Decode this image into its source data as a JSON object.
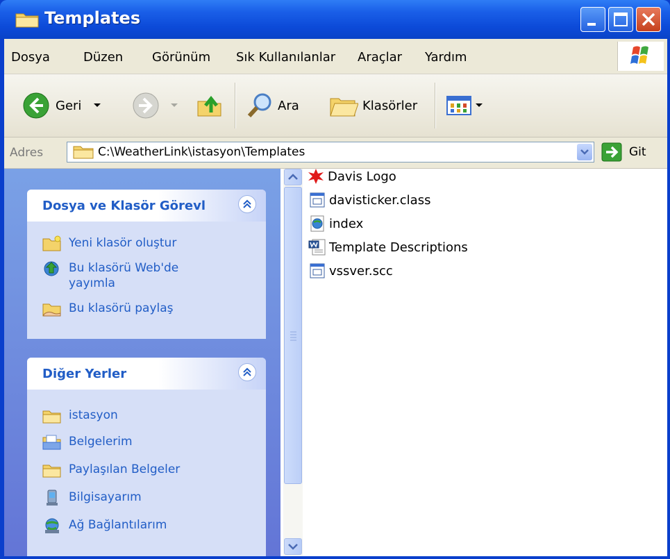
{
  "window": {
    "title": "Templates"
  },
  "menu": [
    "Dosya",
    "Düzen",
    "Görünüm",
    "Sık Kullanılanlar",
    "Araçlar",
    "Yardım"
  ],
  "toolbar": {
    "back_label": "Geri",
    "search_label": "Ara",
    "folders_label": "Klasörler"
  },
  "address": {
    "label": "Adres",
    "path": "C:\\WeatherLink\\istasyon\\Templates",
    "go_label": "Git"
  },
  "tasks_panel": {
    "title": "Dosya ve Klasör Görevl",
    "items": [
      {
        "label": "Yeni klasör oluştur",
        "icon": "new-folder-icon"
      },
      {
        "label": "Bu klasörü Web'de yayımla",
        "icon": "publish-web-icon"
      },
      {
        "label": "Bu klasörü paylaş",
        "icon": "share-folder-icon"
      }
    ]
  },
  "places_panel": {
    "title": "Diğer Yerler",
    "items": [
      {
        "label": "istasyon",
        "icon": "folder-icon"
      },
      {
        "label": "Belgelerim",
        "icon": "my-documents-icon"
      },
      {
        "label": "Paylaşılan Belgeler",
        "icon": "folder-icon"
      },
      {
        "label": "Bilgisayarım",
        "icon": "my-computer-icon"
      },
      {
        "label": "Ağ Bağlantılarım",
        "icon": "network-icon"
      }
    ]
  },
  "files": [
    {
      "name": "Davis Logo",
      "icon": "image-icon"
    },
    {
      "name": "davisticker.class",
      "icon": "generic-file-icon"
    },
    {
      "name": "index",
      "icon": "html-file-icon"
    },
    {
      "name": "Template Descriptions",
      "icon": "word-document-icon"
    },
    {
      "name": "vssver.scc",
      "icon": "generic-file-icon"
    }
  ],
  "colors": {
    "title_bar": "#0a43c8",
    "task_link": "#215dc6",
    "pane_bg": "#6375d6"
  }
}
